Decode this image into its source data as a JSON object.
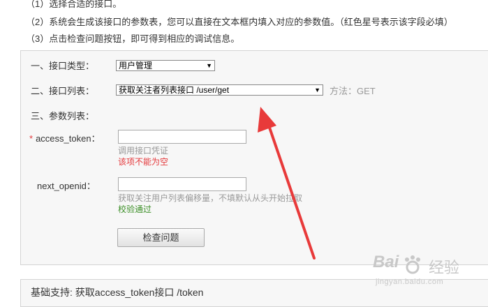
{
  "instructions": [
    "（1）选择合适的接口。",
    "（2）系统会生成该接口的参数表，您可以直接在文本框内填入对应的参数值。（红色星号表示该字段必填）",
    "（3）点击检查问题按钮，即可得到相应的调试信息。"
  ],
  "form": {
    "type_label": "一、接口类型：",
    "type_value": "用户管理",
    "list_label": "二、接口列表：",
    "list_value": "获取关注者列表接口 /user/get",
    "method_text": "方法：GET",
    "params_label": "三、参数列表：",
    "required_mark": "*",
    "param1": {
      "name": "access_token：",
      "value": "",
      "hint": "调用接口凭证",
      "status": "该项不能为空",
      "status_color": "#e4393c"
    },
    "param2": {
      "name": "next_openid：",
      "value": "",
      "hint": "获取关注用户列表偏移量，不填默认从头开始拉取",
      "status": "校验通过",
      "status_color": "#3c8f27"
    },
    "check_button": "检查问题"
  },
  "bottom_text": "基础支持: 获取access_token接口 /token",
  "annotation_arrow_color": "#e83a3a",
  "watermark": {
    "logo": "Bai",
    "logo2": "经验",
    "url": "jingyan.baidu.com"
  }
}
